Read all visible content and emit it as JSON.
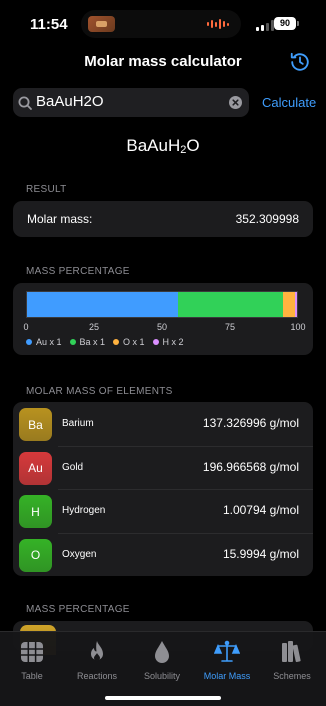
{
  "status_bar": {
    "time": "11:54",
    "battery": "90"
  },
  "nav": {
    "title": "Molar mass calculator",
    "history_icon": "clock-arrow-icon"
  },
  "search": {
    "value": "BaAuH2O",
    "placeholder": "",
    "action": "Calculate"
  },
  "formula": {
    "parts": [
      "BaAuH",
      "2",
      "O"
    ]
  },
  "result": {
    "section": "RESULT",
    "label": "Molar mass:",
    "value": "352.309998"
  },
  "mass_percentage": {
    "section": "MASS PERCENTAGE",
    "ticks": [
      "0",
      "25",
      "50",
      "75",
      "100"
    ],
    "segments": [
      {
        "name": "Au x 1",
        "percent": 55.91,
        "color": "#409cff"
      },
      {
        "name": "Ba x 1",
        "percent": 38.98,
        "color": "#31d158"
      },
      {
        "name": "O x 1",
        "percent": 4.54,
        "color": "#ffb340"
      },
      {
        "name": "H x 2",
        "percent": 0.57,
        "color": "#da8fff"
      }
    ]
  },
  "elements": {
    "section": "MOLAR MASS OF ELEMENTS",
    "items": [
      {
        "symbol": "Ba",
        "name": "Barium",
        "mass": "137.326996 g/mol",
        "color": "#b8921f"
      },
      {
        "symbol": "Au",
        "name": "Gold",
        "mass": "196.966568 g/mol",
        "color": "#d6393b"
      },
      {
        "symbol": "H",
        "name": "Hydrogen",
        "mass": "1.00794 g/mol",
        "color": "#35b226"
      },
      {
        "symbol": "O",
        "name": "Oxygen",
        "mass": "15.9994 g/mol",
        "color": "#35b226"
      }
    ]
  },
  "second_section": {
    "section": "MASS PERCENTAGE"
  },
  "tabs": [
    {
      "label": "Table",
      "icon": "grid-icon",
      "active": false
    },
    {
      "label": "Reactions",
      "icon": "flame-icon",
      "active": false
    },
    {
      "label": "Solubility",
      "icon": "drop-icon",
      "active": false
    },
    {
      "label": "Molar Mass",
      "icon": "scale-icon",
      "active": true
    },
    {
      "label": "Schemes",
      "icon": "books-icon",
      "active": false
    }
  ],
  "colors": {
    "accent": "#3f9dfc",
    "card": "#1c1c1e",
    "background": "#000000"
  }
}
